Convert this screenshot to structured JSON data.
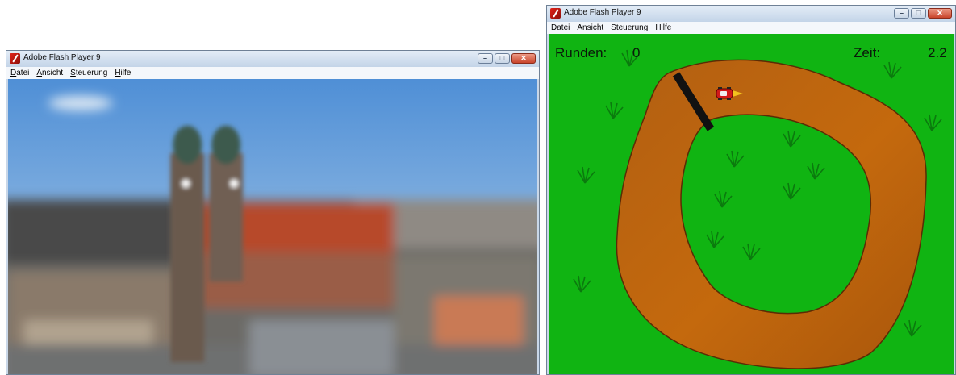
{
  "left_window": {
    "title": "Adobe Flash Player 9",
    "menu": [
      {
        "label": "Datei",
        "accel": "D"
      },
      {
        "label": "Ansicht",
        "accel": "A"
      },
      {
        "label": "Steuerung",
        "accel": "S"
      },
      {
        "label": "Hilfe",
        "accel": "H"
      }
    ],
    "content": "blurred-photo-frauenkirche-munich"
  },
  "right_window": {
    "title": "Adobe Flash Player 9",
    "menu": [
      {
        "label": "Datei",
        "accel": "D"
      },
      {
        "label": "Ansicht",
        "accel": "A"
      },
      {
        "label": "Steuerung",
        "accel": "S"
      },
      {
        "label": "Hilfe",
        "accel": "H"
      }
    ],
    "game": {
      "laps_label": "Runden:",
      "laps_value": "0",
      "time_label": "Zeit:",
      "time_value": "2.2"
    }
  },
  "icons": {
    "app": "flash-player-icon",
    "minimize": "minimize-icon",
    "maximize": "maximize-icon",
    "close": "close-icon"
  },
  "colors": {
    "grass": "#10b412",
    "track": "#b8610c",
    "finish_line": "#111111",
    "car": "#d21a1a",
    "tuft": "#0b7a0e",
    "window_frame": "#c9d7e8"
  }
}
